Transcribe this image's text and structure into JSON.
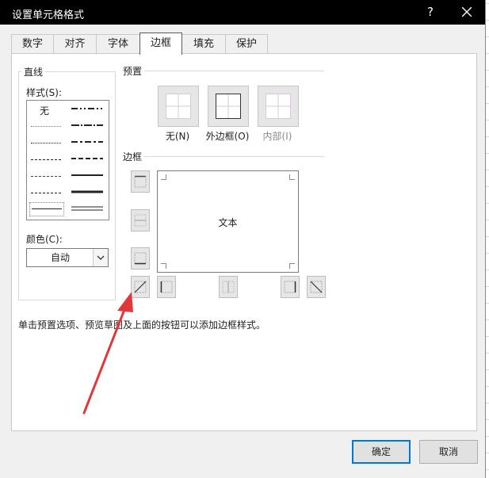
{
  "window": {
    "title": "设置单元格格式",
    "help_label": "?"
  },
  "tabs": [
    {
      "label": "数字"
    },
    {
      "label": "对齐"
    },
    {
      "label": "字体"
    },
    {
      "label": "边框",
      "active": true
    },
    {
      "label": "填充"
    },
    {
      "label": "保护"
    }
  ],
  "line_group": {
    "title": "直线",
    "style_label": "样式(S):",
    "style_none_label": "无",
    "color_label": "颜色(C):",
    "color_value": "自动"
  },
  "preset_group": {
    "title": "预置",
    "none_label": "无(N)",
    "outline_label": "外边框(O)",
    "inside_label": "内部(I)"
  },
  "border_group": {
    "title": "边框",
    "preview_text": "文本"
  },
  "help_text": "单击预置选项、预览草图及上面的按钮可以添加边框样式。",
  "footer": {
    "ok_label": "确定",
    "cancel_label": "取消"
  },
  "colors": {
    "titlebar": "#000000",
    "dialog_bg": "#f0f0f0",
    "accent": "#0078d7",
    "annotation_arrow": "#e0383a"
  }
}
